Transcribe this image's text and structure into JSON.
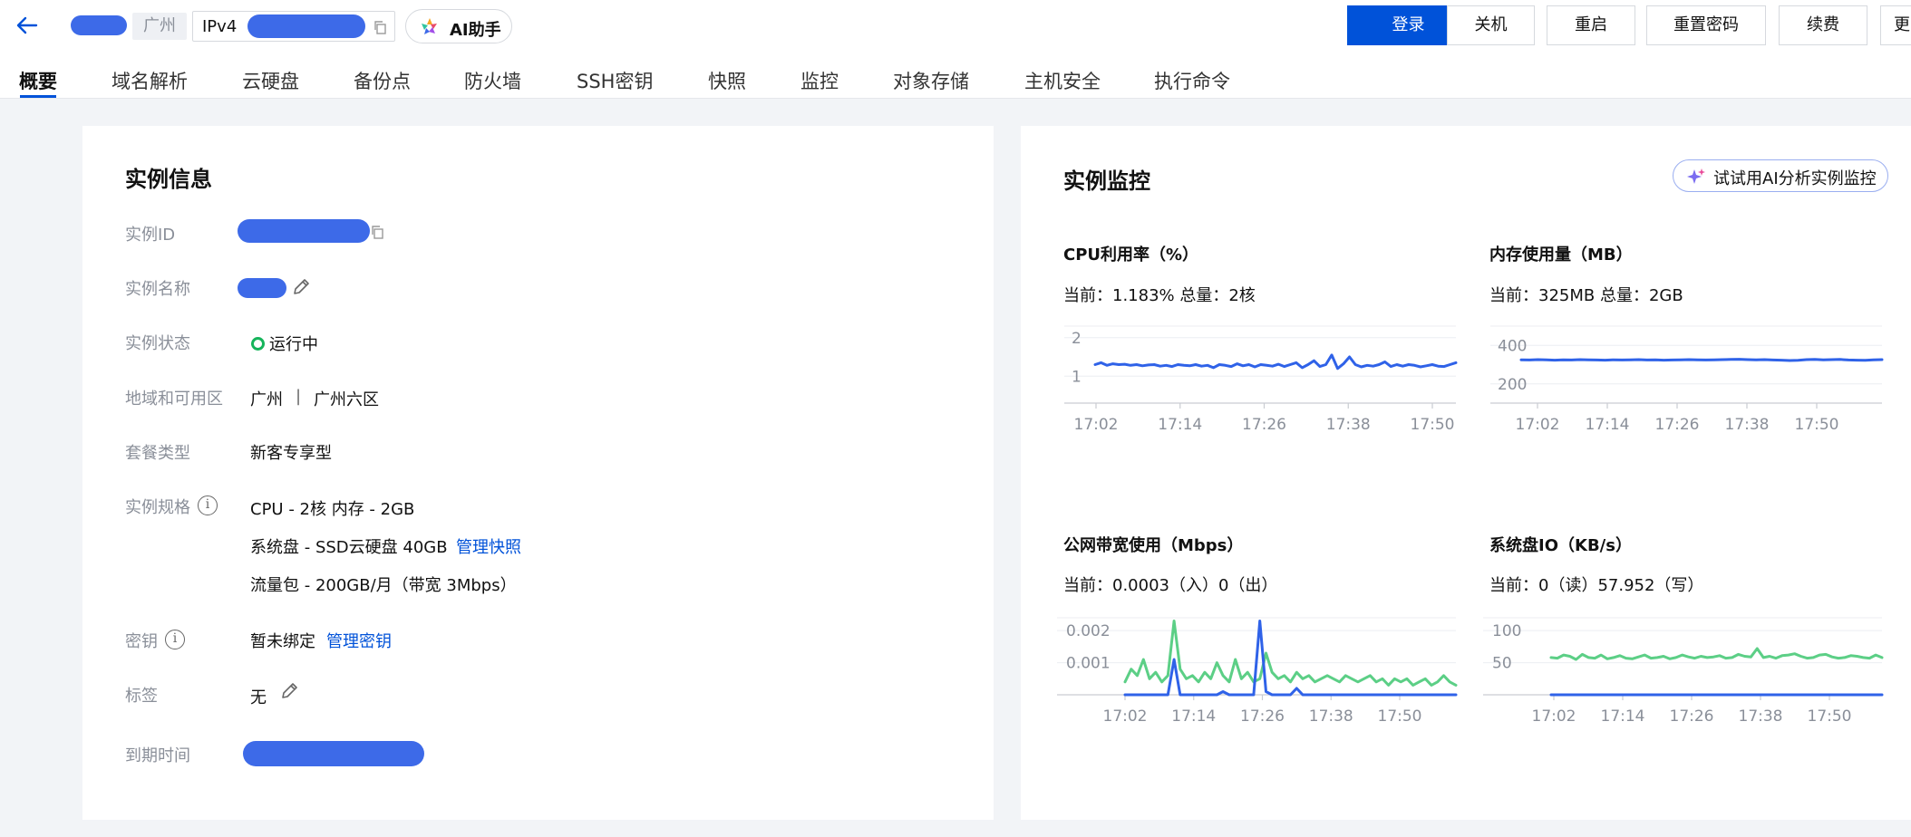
{
  "header": {
    "region": "广州",
    "ip_label": "IPv4",
    "ai_assistant": "AI助手",
    "buttons": [
      "登录",
      "关机",
      "重启",
      "重置密码",
      "续费",
      "更"
    ]
  },
  "tabs": [
    "概要",
    "域名解析",
    "云硬盘",
    "备份点",
    "防火墙",
    "SSH密钥",
    "快照",
    "监控",
    "对象存储",
    "主机安全",
    "执行命令"
  ],
  "instance_info": {
    "title": "实例信息",
    "labels": {
      "id": "实例ID",
      "name": "实例名称",
      "status": "实例状态",
      "region": "地域和可用区",
      "package": "套餐类型",
      "spec": "实例规格",
      "key": "密钥",
      "tags": "标签",
      "expire": "到期时间"
    },
    "status": "运行中",
    "region_value": "广州",
    "zone_value": "广州六区",
    "separator": "|",
    "package": "新客专享型",
    "spec_cpu": "CPU - 2核 内存 - 2GB",
    "spec_disk": "系统盘 - SSD云硬盘 40GB",
    "manage_snapshot": "管理快照",
    "spec_traffic": "流量包 - 200GB/月（带宽 3Mbps）",
    "key_value": "暂未绑定",
    "manage_key": "管理密钥",
    "tags_value": "无",
    "info_glyph": "i"
  },
  "monitor": {
    "title": "实例监控",
    "ai_analyze": "试试用AI分析实例监控",
    "colors": {
      "primary": "#2f62e8",
      "secondary": "#5ccf86"
    }
  },
  "chart_data": [
    {
      "type": "line",
      "title": "CPU利用率（%）",
      "subtitle": "当前：1.183% 总量：2核",
      "x_ticks": [
        "17:02",
        "17:14",
        "17:26",
        "17:38",
        "17:50"
      ],
      "y_ticks": [
        "2",
        "1"
      ],
      "ylim": [
        0.3,
        2.3
      ],
      "series": [
        {
          "values": [
            1.3,
            1.35,
            1.28,
            1.32,
            1.3,
            1.31,
            1.28,
            1.3,
            1.27,
            1.29,
            1.3,
            1.26,
            1.28,
            1.25,
            1.3,
            1.28,
            1.27,
            1.3,
            1.26,
            1.28,
            1.22,
            1.3,
            1.28,
            1.25,
            1.32,
            1.27,
            1.3,
            1.24,
            1.3,
            1.28,
            1.26,
            1.31,
            1.25,
            1.3,
            1.35,
            1.22,
            1.3,
            1.4,
            1.25,
            1.3,
            1.55,
            1.2,
            1.32,
            1.5,
            1.3,
            1.24,
            1.28,
            1.26,
            1.3,
            1.37,
            1.25,
            1.3,
            1.26,
            1.3,
            1.28,
            1.24,
            1.27,
            1.3,
            1.26,
            1.25,
            1.3,
            1.35
          ]
        }
      ]
    },
    {
      "type": "line",
      "title": "内存使用量（MB）",
      "subtitle": "当前：325MB 总量：2GB",
      "x_ticks": [
        "17:02",
        "17:14",
        "17:26",
        "17:38",
        "17:50"
      ],
      "y_ticks": [
        "400",
        "200"
      ],
      "ylim": [
        100,
        500
      ],
      "series": [
        {
          "values": [
            325,
            324,
            326,
            325,
            323,
            325,
            324,
            326,
            325,
            324,
            323,
            325,
            324,
            325,
            326,
            324,
            325,
            323,
            324,
            325,
            326,
            325,
            324,
            325,
            326,
            327,
            328,
            326,
            325,
            326,
            324,
            323,
            321,
            322,
            326,
            327,
            325,
            326,
            327,
            324,
            323,
            322,
            325,
            326
          ]
        }
      ]
    },
    {
      "type": "line",
      "title": "公网带宽使用（Mbps）",
      "subtitle": "当前：0.0003（入）0（出）",
      "x_ticks": [
        "17:02",
        "17:14",
        "17:26",
        "17:38",
        "17:50"
      ],
      "y_ticks": [
        "0.002",
        "0.001"
      ],
      "ylim": [
        0,
        0.0024
      ],
      "series": [
        {
          "values": [
            0.0004,
            0.0008,
            0.0006,
            0.0011,
            0.0005,
            0.0007,
            0.0004,
            0.0006,
            0.0023,
            0.0008,
            0.0005,
            0.0006,
            0.0004,
            0.0007,
            0.0005,
            0.001,
            0.0006,
            0.0004,
            0.0011,
            0.0005,
            0.0007,
            0.0004,
            0.0005,
            0.0013,
            0.0007,
            0.0005,
            0.0006,
            0.0004,
            0.0007,
            0.0005,
            0.0006,
            0.0004,
            0.0005,
            0.0006,
            0.0005,
            0.0004,
            0.0006,
            0.0005,
            0.0004,
            0.0005,
            0.0006,
            0.0004,
            0.0005,
            0.0003,
            0.0005,
            0.0004,
            0.0005,
            0.0003,
            0.0004,
            0.0005,
            0.0003,
            0.0004,
            0.0006,
            0.0004,
            0.0003
          ]
        },
        {
          "values": [
            0,
            0,
            0,
            0,
            0,
            0,
            0,
            0,
            0.0011,
            0,
            0,
            0,
            0,
            0,
            0,
            0,
            0.0001,
            0,
            0,
            0,
            0,
            0,
            0.0023,
            0.0001,
            0,
            0,
            0,
            0,
            0.0002,
            0,
            0,
            0,
            0,
            0,
            0,
            0,
            0,
            0,
            0,
            0,
            0,
            0,
            0,
            0,
            0,
            0,
            0,
            0,
            0,
            0,
            0,
            0,
            0,
            0,
            0
          ]
        }
      ]
    },
    {
      "type": "line",
      "title": "系统盘IO（KB/s）",
      "subtitle": "当前：0（读）57.952（写）",
      "x_ticks": [
        "17:02",
        "17:14",
        "17:26",
        "17:38",
        "17:50"
      ],
      "y_ticks": [
        "100",
        "50"
      ],
      "ylim": [
        0,
        120
      ],
      "series": [
        {
          "values": [
            58,
            57,
            62,
            60,
            55,
            63,
            58,
            57,
            62,
            56,
            58,
            61,
            57,
            56,
            59,
            62,
            57,
            58,
            60,
            56,
            58,
            62,
            59,
            57,
            60,
            58,
            59,
            61,
            57,
            58,
            63,
            60,
            59,
            72,
            58,
            60,
            57,
            61,
            62,
            64,
            60,
            57,
            58,
            62,
            63,
            59,
            57,
            58,
            61,
            60,
            58,
            57,
            62,
            58
          ]
        },
        {
          "values": [
            0,
            0,
            0,
            0,
            0,
            0,
            0,
            0,
            0,
            0,
            0,
            0,
            0,
            0,
            0,
            0,
            0,
            0,
            0,
            0,
            0,
            0,
            0,
            0,
            0,
            0,
            0,
            0,
            0,
            0,
            0,
            0,
            0,
            0,
            0,
            0,
            0,
            0,
            0,
            0,
            0,
            0,
            0,
            0,
            0,
            0,
            0,
            0,
            0,
            0,
            0,
            0,
            0,
            0
          ]
        }
      ]
    }
  ]
}
